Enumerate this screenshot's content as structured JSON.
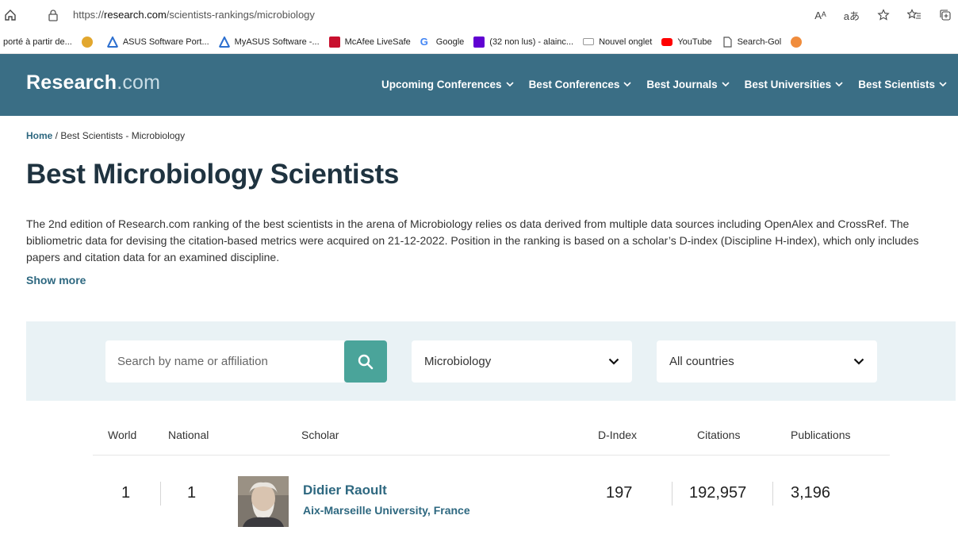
{
  "browser": {
    "url_prefix": "https://",
    "url_host": "research.com",
    "url_path": "/scientists-rankings/microbiology",
    "read_aloud": "Aᴬ",
    "translate": "aあ",
    "bookmarks": [
      {
        "label": "porté à partir de...",
        "color": ""
      },
      {
        "label": "",
        "color": "#e2a72e"
      },
      {
        "label": "ASUS Software Port...",
        "color": "#2c6fcf"
      },
      {
        "label": "MyASUS Software -...",
        "color": "#2c6fcf"
      },
      {
        "label": "McAfee LiveSafe",
        "color": "#c8102e"
      },
      {
        "label": "Google",
        "color": "#4285f4"
      },
      {
        "label": "(32 non lus) - alainc...",
        "color": "#6001d2"
      },
      {
        "label": "Nouvel onglet",
        "color": "#999999"
      },
      {
        "label": "YouTube",
        "color": "#ff0000"
      },
      {
        "label": "Search-Gol",
        "color": "#555555"
      },
      {
        "label": "",
        "color": "#f08c3c"
      }
    ]
  },
  "header": {
    "logo_main": "Research",
    "logo_suffix": ".com",
    "nav": [
      {
        "label": "Upcoming Conferences"
      },
      {
        "label": "Best Conferences"
      },
      {
        "label": "Best Journals"
      },
      {
        "label": "Best Universities"
      },
      {
        "label": "Best Scientists"
      }
    ]
  },
  "breadcrumb": {
    "home": "Home",
    "separator": " / ",
    "current": "Best Scientists - Microbiology"
  },
  "page": {
    "title": "Best Microbiology Scientists",
    "intro": "The 2nd edition of Research.com ranking of the best scientists in the arena of Microbiology relies os data derived from multiple data sources including OpenAlex and CrossRef. The bibliometric data for devising the citation-based metrics were acquired on 21-12-2022. Position in the ranking is based on a scholar’s D-index (Discipline H-index), which only includes papers and citation data for an examined discipline.",
    "show_more": "Show more"
  },
  "filters": {
    "search_placeholder": "Search by name or affiliation",
    "discipline": "Microbiology",
    "country": "All countries"
  },
  "table": {
    "headers": {
      "world": "World",
      "national": "National",
      "scholar": "Scholar",
      "dindex": "D-Index",
      "citations": "Citations",
      "publications": "Publications"
    },
    "rows": [
      {
        "world": "1",
        "national": "1",
        "name": "Didier Raoult",
        "affiliation": "Aix-Marseille University, France",
        "dindex": "197",
        "citations": "192,957",
        "publications": "3,196"
      }
    ]
  },
  "colors": {
    "header_bg": "#3a6e85",
    "accent_link": "#2e6880",
    "search_button": "#4aa49a",
    "filter_bg": "#e9f2f5"
  }
}
